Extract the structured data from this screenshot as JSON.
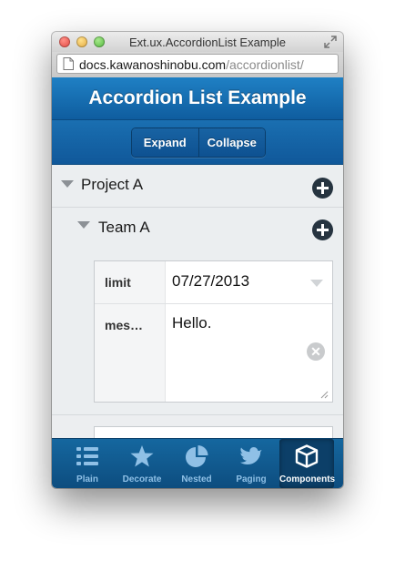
{
  "window": {
    "title": "Ext.ux.AccordionList Example",
    "url_host": "docs.kawanoshinobu.com",
    "url_path": "/accordionlist/"
  },
  "app": {
    "title": "Accordion List Example",
    "expand_label": "Expand",
    "collapse_label": "Collapse"
  },
  "list": {
    "project_label": "Project A",
    "team_label": "Team A"
  },
  "form": {
    "limit_label": "limit",
    "limit_value": "07/27/2013",
    "message_label": "mes…",
    "message_value": "Hello."
  },
  "tabs": [
    {
      "label": "Plain",
      "icon": "list-icon",
      "active": false
    },
    {
      "label": "Decorate",
      "icon": "star-icon",
      "active": false
    },
    {
      "label": "Nested",
      "icon": "pie-chart-icon",
      "active": false
    },
    {
      "label": "Paging",
      "icon": "bird-icon",
      "active": false
    },
    {
      "label": "Components",
      "icon": "box-icon",
      "active": true
    }
  ],
  "colors": {
    "header_blue": "#1f80c4",
    "toolbar_blue": "#10589a",
    "tab_active_text": "#ffffff",
    "tab_inactive_text": "#8fc0e6"
  }
}
